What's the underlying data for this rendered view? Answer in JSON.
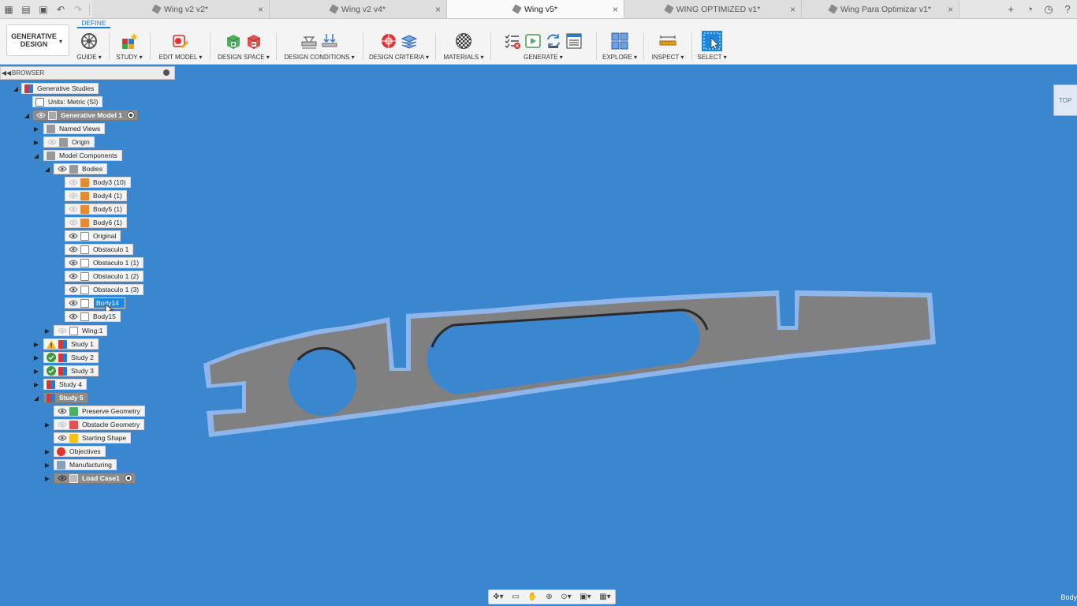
{
  "tabs": [
    {
      "label": "Wing v2 v2*",
      "active": false
    },
    {
      "label": "Wing v2 v4*",
      "active": false
    },
    {
      "label": "Wing v5*",
      "active": true
    },
    {
      "label": "WING OPTIMIZED v1*",
      "active": false
    },
    {
      "label": "Wing Para Optimizar v1*",
      "active": false
    }
  ],
  "toolbar": {
    "workspace_label": "GENERATIVE DESIGN",
    "define_tab": "DEFINE",
    "groups": [
      {
        "label": "GUIDE ▾"
      },
      {
        "label": "STUDY ▾"
      },
      {
        "label": "EDIT MODEL ▾"
      },
      {
        "label": "DESIGN SPACE ▾"
      },
      {
        "label": "DESIGN CONDITIONS ▾"
      },
      {
        "label": "DESIGN CRITERIA ▾"
      },
      {
        "label": "MATERIALS ▾"
      },
      {
        "label": "GENERATE ▾"
      },
      {
        "label": "EXPLORE ▾"
      },
      {
        "label": "INSPECT ▾"
      },
      {
        "label": "SELECT ▾"
      }
    ]
  },
  "browser": {
    "title": "BROWSER",
    "tree": [
      {
        "label": "Generative Studies"
      },
      {
        "label": "Units: Metric (SI)"
      },
      {
        "label": "Generative Model 1"
      },
      {
        "label": "Named Views"
      },
      {
        "label": "Origin"
      },
      {
        "label": "Model Components"
      },
      {
        "label": "Bodies"
      },
      {
        "label": "Body3 (10)"
      },
      {
        "label": "Body4 (1)"
      },
      {
        "label": "Body5 (1)"
      },
      {
        "label": "Body6 (1)"
      },
      {
        "label": "Original"
      },
      {
        "label": "Obstaculo 1"
      },
      {
        "label": "Obstaculo 1 (1)"
      },
      {
        "label": "Obstaculo 1 (2)"
      },
      {
        "label": "Obstaculo 1 (3)"
      },
      {
        "label": "Body14"
      },
      {
        "label": "Body15"
      },
      {
        "label": "Wing:1"
      },
      {
        "label": "Study 1"
      },
      {
        "label": "Study 2"
      },
      {
        "label": "Study 3"
      },
      {
        "label": "Study 4"
      },
      {
        "label": "Study 5"
      },
      {
        "label": "Preserve Geometry"
      },
      {
        "label": "Obstacle Geometry"
      },
      {
        "label": "Starting Shape"
      },
      {
        "label": "Objectives"
      },
      {
        "label": "Manufacturing"
      },
      {
        "label": "Load Case1"
      }
    ]
  },
  "viewcube_label": "TOP",
  "status_label": "Body",
  "colors": {
    "canvas": "#3a86cf",
    "part_fill": "#808080",
    "part_outline": "#8fb6ea",
    "accent": "#1d86de"
  }
}
